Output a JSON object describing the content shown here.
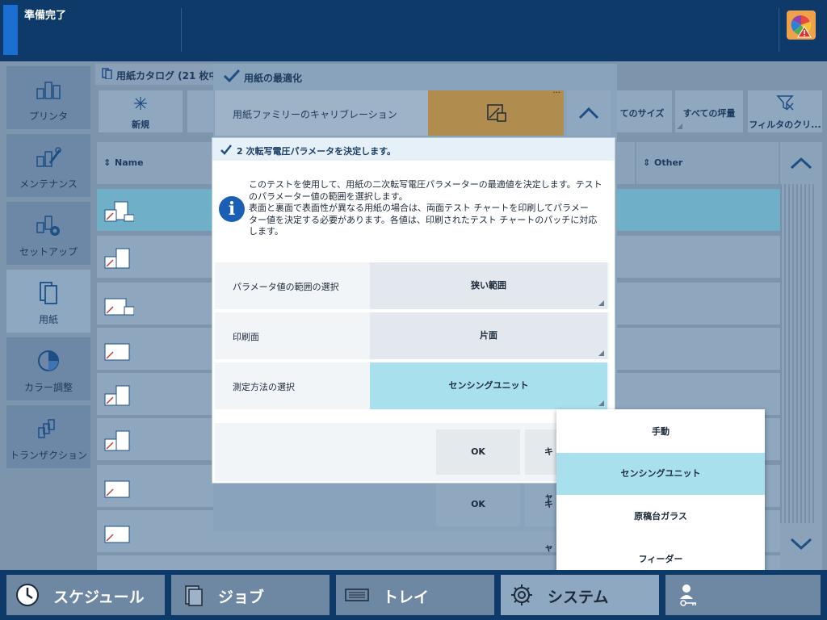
{
  "status": {
    "text": "準備完了"
  },
  "sidebar": {
    "items": [
      {
        "label": "プリンタ"
      },
      {
        "label": "メンテナンス"
      },
      {
        "label": "セットアップ"
      },
      {
        "label": "用紙"
      },
      {
        "label": "カラー調整"
      },
      {
        "label": "トランザクション"
      }
    ]
  },
  "catalog": {
    "title": "用紙カタログ (21 枚中、",
    "toolbar": {
      "new_label": "新規",
      "all_sizes": "てのサイズ",
      "all_weights": "すべての坪量",
      "filter_clear": "フィルタのクリ..."
    },
    "columns": {
      "name": "Name",
      "other": "Other"
    }
  },
  "optimize": {
    "title": "用紙の最適化",
    "family_label": "用紙ファミリーのキャリブレーション",
    "behind_ok_label": "OK",
    "behind_cancel_label": "キャ"
  },
  "dialog": {
    "title": "2 次転写電圧パラメータを決定します。",
    "info_lines": [
      "このテストを使用して、用紙の二次転写電圧パラメーターの最適値を決定します。テスト",
      "のパラメーター値の範囲を選択します。",
      "表面と裏面で表面性が異なる用紙の場合は、両面テスト チャートを印刷してパラメー",
      "ター値を決定する必要があります。各値は、印刷されたテスト チャートのパッチに対応",
      "します。"
    ],
    "params": [
      {
        "label": "パラメータ値の範囲の選択",
        "value": "狭い範囲"
      },
      {
        "label": "印刷面",
        "value": "片面"
      },
      {
        "label": "測定方法の選択",
        "value": "センシングユニット"
      }
    ],
    "ok_label": "OK",
    "cancel_label": "キャ"
  },
  "dropdown": {
    "options": [
      "手動",
      "センシングユニット",
      "原稿台ガラス",
      "フィーダー"
    ],
    "selected": "センシングユニット"
  },
  "bottom_nav": [
    {
      "label": "スケジュール"
    },
    {
      "label": "ジョブ"
    },
    {
      "label": "トレイ"
    },
    {
      "label": "システム"
    }
  ],
  "colors": {
    "accent": "#1a6fd0",
    "selected": "#a9e0ee",
    "topbar": "#0d3a68"
  }
}
